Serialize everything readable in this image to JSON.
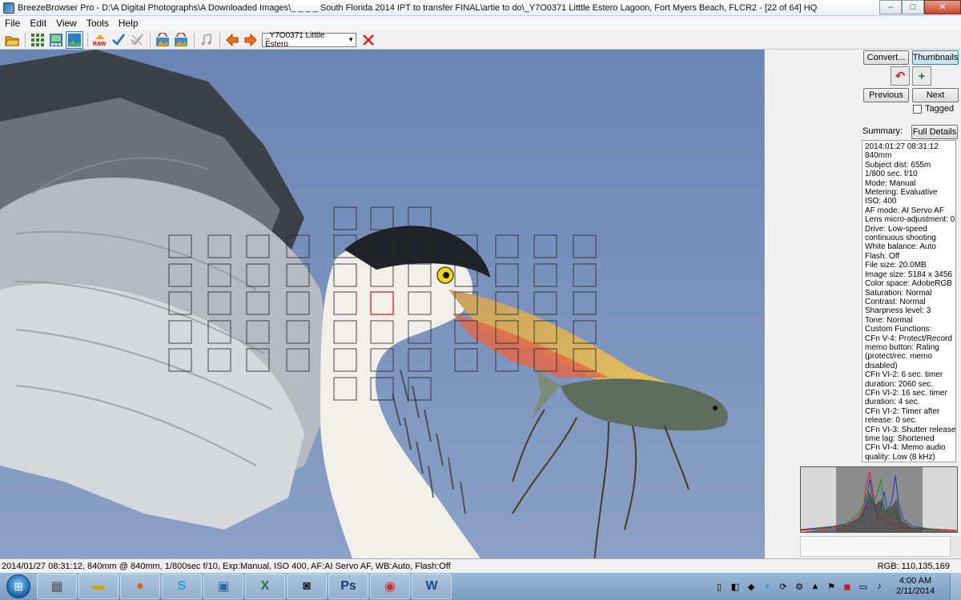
{
  "window": {
    "title": "BreezeBrowser Pro - D:\\A Digital Photographs\\A Downloaded Images\\_ _ _ _ South Florida 2014 IPT to transfer FINAL\\artie to do\\_Y7O0371  Litttle Estero Lagoon, Fort Myers Beach, FLCR2 - [22 of 64]  HQ",
    "minimize": "–",
    "maximize": "□",
    "close": "✕"
  },
  "menu": [
    "File",
    "Edit",
    "View",
    "Tools",
    "Help"
  ],
  "toolbar": {
    "raw_label": "RAW",
    "file_select": "_Y7O0371  Litttle Estero"
  },
  "panel": {
    "convert": "Convert...",
    "thumbnails": "Thumbnails",
    "previous": "Previous",
    "next": "Next",
    "tagged": "Tagged",
    "summary": "Summary:",
    "full_details": "Full Details",
    "details": [
      "2014:01:27 08:31:12",
      "840mm",
      "Subject dist: 655m",
      "1/800 sec. f/10",
      "Mode: Manual",
      "Metering: Evaluative",
      "ISO: 400",
      "AF mode: AI Servo AF",
      "Lens micro-adjustment: 0",
      "Drive: Low-speed",
      "continuous shooting",
      "White balance: Auto",
      "Flash: Off",
      "File size: 20.0MB",
      "Image size: 5184 x 3456",
      "Color space: AdobeRGB",
      "Saturation: Normal",
      "Contrast: Normal",
      "Sharpness level: 3",
      "Tone: Normal",
      "Custom Functions:",
      "CFn V-4: Protect/Record",
      "memo button: Rating",
      "(protect/rec. memo",
      "disabled)",
      "CFn VI-2: 6 sec. timer",
      "duration: 2060 sec.",
      "CFn VI-2: 16 sec. timer",
      "duration: 4 sec.",
      "CFn VI-2: Timer after",
      "release: 0 sec.",
      "CFn VI-3: Shutter release",
      "time lag: Shortened",
      "CFn VI-4: Memo audio",
      "quality: Low (8 kHz)"
    ]
  },
  "status": {
    "left": "2014/01/27 08:31:12, 840mm @ 840mm, 1/800sec f/10, Exp:Manual, ISO 400, AF:AI Servo AF, WB:Auto, Flash:Off",
    "rgb": "RGB: 110,135,169"
  },
  "taskbar": {
    "time": "4:00 AM",
    "date": "2/11/2014",
    "apps": [
      "calculator",
      "folder",
      "firefox",
      "skype",
      "network",
      "excel",
      "camera",
      "photoshop",
      "chrome",
      "word"
    ]
  },
  "colors": {
    "sky": "#6f88b6",
    "af_point": "#2a2a2a",
    "af_active": "#d42020"
  }
}
